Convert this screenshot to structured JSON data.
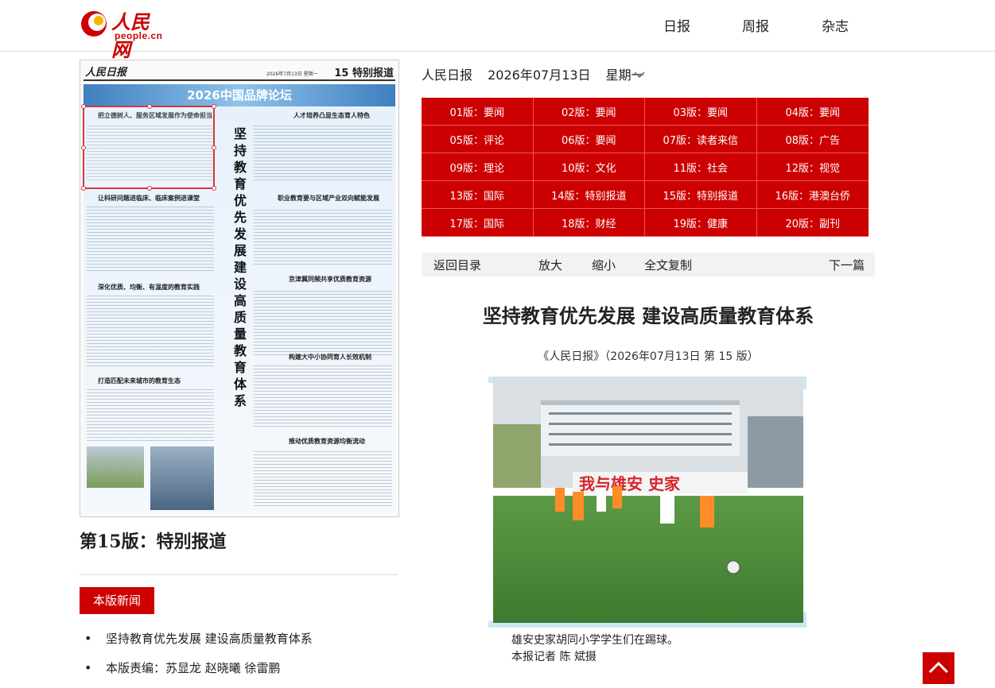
{
  "header": {
    "logo_cn": "人民网",
    "logo_en": "people.cn",
    "nav": [
      "日报",
      "周报",
      "杂志"
    ]
  },
  "paper": {
    "masthead": "人民日报",
    "date_line": "2026年7月13日 星期一",
    "page_label": "15  特别报道",
    "banner": "2026中国品牌论坛",
    "vertical_title": "坚持教育优先发展  建设高质量教育体系",
    "articles": [
      "把立德树人、服务区域发展作为使命担当",
      "人才培养凸显生态育人特色",
      "让科研问题进临床、临床案例进课堂",
      "职业教育要与区域产业双向赋能发展",
      "深化优质、均衡、有温度的教育实践",
      "京津冀同频共享优质教育资源",
      "打造匹配未来城市的教育生态",
      "构建大中小协同育人长效机制",
      "推动优质教育资源均衡流动"
    ]
  },
  "page_title": "第15版：特别报道",
  "news_tab": "本版新闻",
  "news_items": [
    "坚持教育优先发展  建设高质量教育体系",
    "本版责编：苏显龙  赵晓曦  徐雷鹏"
  ],
  "date_bar": {
    "paper": "人民日报",
    "date": "2026年07月13日",
    "weekday": "星期一"
  },
  "versions": [
    "01版：要闻",
    "02版：要闻",
    "03版：要闻",
    "04版：要闻",
    "05版：评论",
    "06版：要闻",
    "07版：读者来信",
    "08版：广告",
    "09版：理论",
    "10版：文化",
    "11版：社会",
    "12版：视觉",
    "13版：国际",
    "14版：特别报道",
    "15版：特别报道",
    "16版：港澳台侨",
    "17版：国际",
    "18版：财经",
    "19版：健康",
    "20版：副刊"
  ],
  "toolbar": {
    "back": "返回目录",
    "zoom_in": "放大",
    "zoom_out": "缩小",
    "copy": "全文复制",
    "next": "下一篇"
  },
  "article": {
    "title": "坚持教育优先发展 建设高质量教育体系",
    "source": "《人民日报》（2026年07月13日   第   15   版）",
    "photo_banner": "我与雄安    史家",
    "caption_1": "雄安史家胡同小学学生们在踢球。",
    "caption_2": "本报记者  陈  斌摄"
  },
  "colors": {
    "brand_red": "#cc0000",
    "toolbar_bg": "#f2f2f2"
  },
  "icons": [
    "chevron-down-icon",
    "back-to-top-icon"
  ]
}
